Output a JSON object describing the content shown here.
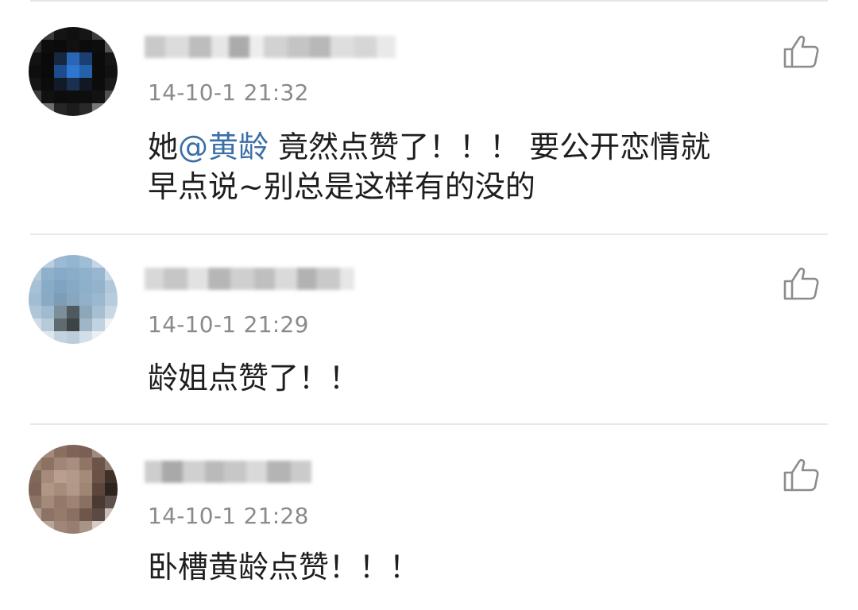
{
  "comments": [
    {
      "avatar_colors": "dark-with-blue-center",
      "username_blurred": true,
      "timestamp": "14-10-1 21:32",
      "text_before": "她",
      "mention": "@黄龄",
      "text_after_line1": " 竟然点赞了！！！ 要公开恋情就",
      "text_line2": "早点说~别总是这样有的没的",
      "like_icon": "thumbs-up-icon"
    },
    {
      "avatar_colors": "light-blue-grey",
      "username_blurred": true,
      "timestamp": "14-10-1 21:29",
      "text": "龄姐点赞了！！",
      "like_icon": "thumbs-up-icon"
    },
    {
      "avatar_colors": "brown-tones",
      "username_blurred": true,
      "timestamp": "14-10-1 21:28",
      "text": "卧槽黄龄点赞！！！",
      "like_icon": "thumbs-up-icon"
    }
  ],
  "colors": {
    "mention": "#3b6fa8",
    "timestamp": "#8a8a8a",
    "text": "#1e1e1e",
    "divider": "#e8e8e8",
    "icon": "#8c8c8c"
  }
}
